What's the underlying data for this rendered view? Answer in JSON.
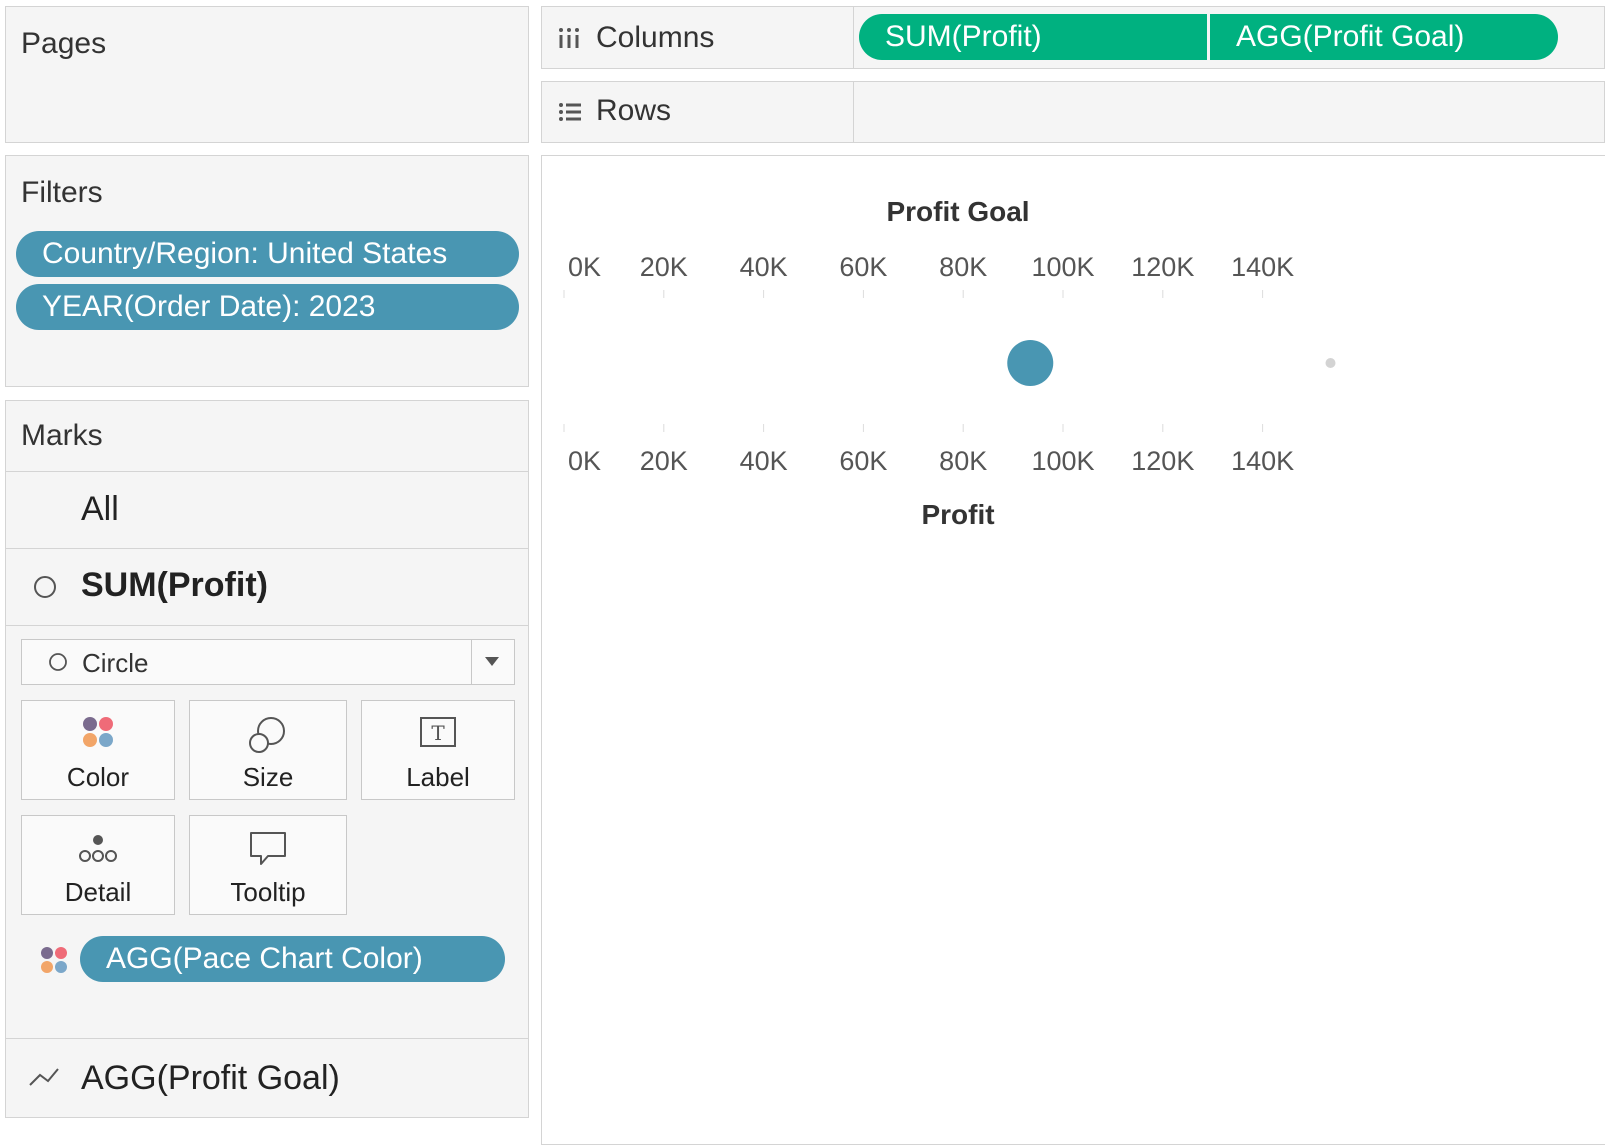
{
  "pages": {
    "title": "Pages"
  },
  "filters": {
    "title": "Filters",
    "pills": [
      "Country/Region: United States",
      "YEAR(Order Date): 2023"
    ]
  },
  "marks": {
    "title": "Marks",
    "all_label": "All",
    "sum_profit_label": "SUM(Profit)",
    "mark_type": "Circle",
    "cards": {
      "color": "Color",
      "size": "Size",
      "label": "Label",
      "detail": "Detail",
      "tooltip": "Tooltip"
    },
    "color_pill": "AGG(Pace Chart Color)",
    "profit_goal_label": "AGG(Profit Goal)"
  },
  "shelves": {
    "columns_label": "Columns",
    "rows_label": "Rows",
    "column_pills": [
      "SUM(Profit)",
      "AGG(Profit Goal)"
    ]
  },
  "colors": {
    "pill_blue": "#4996b2",
    "pill_green": "#00b180",
    "mark_blue": "#4996b2",
    "goal_dot": "#d3d3d3"
  },
  "chart_data": {
    "type": "scatter",
    "top_axis_title": "Profit Goal",
    "bottom_axis_title": "Profit",
    "ticks": [
      "0K",
      "20K",
      "40K",
      "60K",
      "80K",
      "100K",
      "120K",
      "140K"
    ],
    "tick_values": [
      0,
      20000,
      40000,
      60000,
      80000,
      100000,
      120000,
      140000
    ],
    "xlim": [
      0,
      140000
    ],
    "series": [
      {
        "name": "SUM(Profit)",
        "value": 93440,
        "mark": "circle"
      },
      {
        "name": "AGG(Profit Goal)",
        "value": 150000,
        "mark": "dot"
      }
    ]
  }
}
